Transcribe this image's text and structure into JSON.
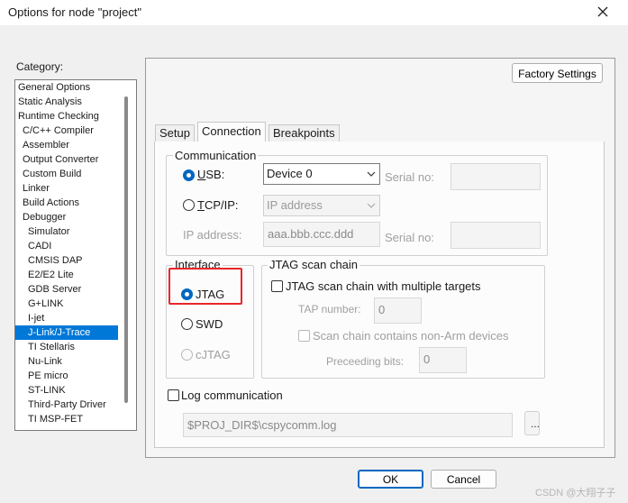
{
  "window": {
    "title": "Options for node \"project\""
  },
  "category": {
    "label": "Category:",
    "items": [
      {
        "label": "General Options",
        "level": 0
      },
      {
        "label": "Static Analysis",
        "level": 0
      },
      {
        "label": "Runtime Checking",
        "level": 0
      },
      {
        "label": "C/C++ Compiler",
        "level": 1
      },
      {
        "label": "Assembler",
        "level": 1
      },
      {
        "label": "Output Converter",
        "level": 1
      },
      {
        "label": "Custom Build",
        "level": 1
      },
      {
        "label": "Linker",
        "level": 1
      },
      {
        "label": "Build Actions",
        "level": 1
      },
      {
        "label": "Debugger",
        "level": 1
      },
      {
        "label": "Simulator",
        "level": 2
      },
      {
        "label": "CADI",
        "level": 2
      },
      {
        "label": "CMSIS DAP",
        "level": 2
      },
      {
        "label": "E2/E2 Lite",
        "level": 2
      },
      {
        "label": "GDB Server",
        "level": 2
      },
      {
        "label": "G+LINK",
        "level": 2
      },
      {
        "label": "I-jet",
        "level": 2
      },
      {
        "label": "J-Link/J-Trace",
        "level": 2,
        "selected": true
      },
      {
        "label": "TI Stellaris",
        "level": 2
      },
      {
        "label": "Nu-Link",
        "level": 2
      },
      {
        "label": "PE micro",
        "level": 2
      },
      {
        "label": "ST-LINK",
        "level": 2
      },
      {
        "label": "Third-Party Driver",
        "level": 2
      },
      {
        "label": "TI MSP-FET",
        "level": 2
      }
    ]
  },
  "factory_settings": "Factory Settings",
  "tabs": [
    {
      "label": "Setup",
      "active": false
    },
    {
      "label": "Connection",
      "active": true
    },
    {
      "label": "Breakpoints",
      "active": false
    }
  ],
  "communication": {
    "group_label": "Communication",
    "usb_label": "USB:",
    "usb_device": "Device 0",
    "serial_no_label_1": "Serial no:",
    "tcpip_label": "TCP/IP:",
    "tcpip_mode": "IP address",
    "ip_address_label": "IP address:",
    "ip_address_value": "aaa.bbb.ccc.ddd",
    "serial_no_label_2": "Serial no:"
  },
  "interface": {
    "group_label": "Interface",
    "jtag": "JTAG",
    "swd": "SWD",
    "cjtag": "cJTAG"
  },
  "jtag_scan_chain": {
    "group_label": "JTAG scan chain",
    "multiple_targets": "JTAG scan chain with multiple targets",
    "tap_number_label": "TAP number:",
    "tap_number_value": "0",
    "non_arm": "Scan chain contains non-Arm devices",
    "preceding_bits_label": "Preceeding bits:",
    "preceding_bits_value": "0"
  },
  "log": {
    "label": "Log communication",
    "path": "$PROJ_DIR$\\cspycomm.log",
    "browse": "..."
  },
  "buttons": {
    "ok": "OK",
    "cancel": "Cancel"
  },
  "watermark": "CSDN @大翔子子",
  "colors": {
    "selection": "#0078d7",
    "highlight_box": "#e8262a",
    "radio_checked": "#0067c0"
  }
}
